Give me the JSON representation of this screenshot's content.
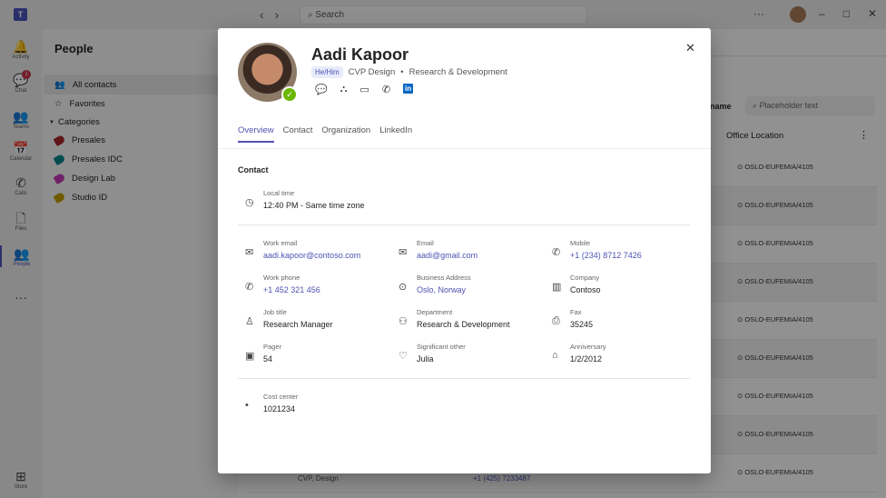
{
  "titlebar": {
    "search_placeholder": "Search",
    "more": "···",
    "logo": "T"
  },
  "rail": [
    {
      "label": "Activity",
      "icon": "bell-icon",
      "glyph": "🔔"
    },
    {
      "label": "Chat",
      "icon": "chat-icon",
      "glyph": "💬",
      "badge": "1"
    },
    {
      "label": "Teams",
      "icon": "teams-icon",
      "glyph": "👥"
    },
    {
      "label": "Calendar",
      "icon": "calendar-icon",
      "glyph": "📅"
    },
    {
      "label": "Calls",
      "icon": "phone-icon",
      "glyph": "✆"
    },
    {
      "label": "Files",
      "icon": "file-icon",
      "glyph": "🗋"
    },
    {
      "label": "People",
      "icon": "people-icon",
      "glyph": "👥",
      "selected": true
    },
    {
      "label": "",
      "icon": "more-icon",
      "glyph": "···"
    },
    {
      "label": "Store",
      "icon": "store-icon",
      "glyph": "⊞"
    }
  ],
  "people": {
    "title": "People",
    "all_contacts": "All contacts",
    "favorites": "Favorites",
    "categories": "Categories",
    "category_items": [
      {
        "label": "Presales",
        "color": "#a4262c"
      },
      {
        "label": "Presales IDC",
        "color": "#038387"
      },
      {
        "label": "Design Lab",
        "color": "#c239b3"
      },
      {
        "label": "Studio ID",
        "color": "#c19c00"
      }
    ]
  },
  "list": {
    "filter_label": "name",
    "filter_placeholder": "Placeholder text",
    "column_office": "Office Location",
    "location": "OSLO-EUFEMIA/4105",
    "last_row": {
      "title": "CVP, Design",
      "phone": "+1 (425) 7233487"
    }
  },
  "profile": {
    "name": "Aadi Kapoor",
    "pronouns": "He/Him",
    "title": "CVP Design",
    "department": "Research & Development",
    "presence": "available",
    "presence_color": "#6bb700",
    "tabs": [
      "Overview",
      "Contact",
      "Organization",
      "LinkedIn"
    ],
    "selected_tab": "Overview",
    "section": "Contact",
    "local_time": {
      "label": "Local time",
      "value": "12:40 PM - Same time zone"
    },
    "fields": [
      {
        "label": "Work email",
        "value": "aadi.kapoor@contoso.com",
        "link": true,
        "icon": "mail-icon",
        "glyph": "✉"
      },
      {
        "label": "Email",
        "value": "aadi@gmail.com",
        "link": true,
        "icon": "mail-icon",
        "glyph": "✉"
      },
      {
        "label": "Mobile",
        "value": "+1 (234) 8712 7426",
        "link": true,
        "icon": "phone-icon",
        "glyph": "✆"
      },
      {
        "label": "Work phone",
        "value": "+1 452 321 456",
        "link": true,
        "icon": "phone-icon",
        "glyph": "✆"
      },
      {
        "label": "Business Address",
        "value": "Oslo, Norway",
        "link": true,
        "icon": "location-icon",
        "glyph": "⊙"
      },
      {
        "label": "Company",
        "value": "Contoso",
        "link": false,
        "icon": "building-icon",
        "glyph": "▥"
      },
      {
        "label": "Job title",
        "value": "Research Manager",
        "link": false,
        "icon": "person-icon",
        "glyph": "♙"
      },
      {
        "label": "Department",
        "value": "Research & Development",
        "link": false,
        "icon": "people-group-icon",
        "glyph": "⚇"
      },
      {
        "label": "Fax",
        "value": "35245",
        "link": false,
        "icon": "fax-icon",
        "glyph": "⎙"
      },
      {
        "label": "Pager",
        "value": "54",
        "link": false,
        "icon": "pager-icon",
        "glyph": "▣"
      },
      {
        "label": "Significant other",
        "value": "Julia",
        "link": false,
        "icon": "heart-icon",
        "glyph": "♡"
      },
      {
        "label": "Anniversary",
        "value": "1/2/2012",
        "link": false,
        "icon": "cake-icon",
        "glyph": "⌂"
      }
    ],
    "cost_center": {
      "label": "Cost center",
      "value": "1021234"
    }
  },
  "colors": {
    "accent": "#4f52b2",
    "link": "#4f52b2",
    "linkedin": "#0a66c2"
  }
}
